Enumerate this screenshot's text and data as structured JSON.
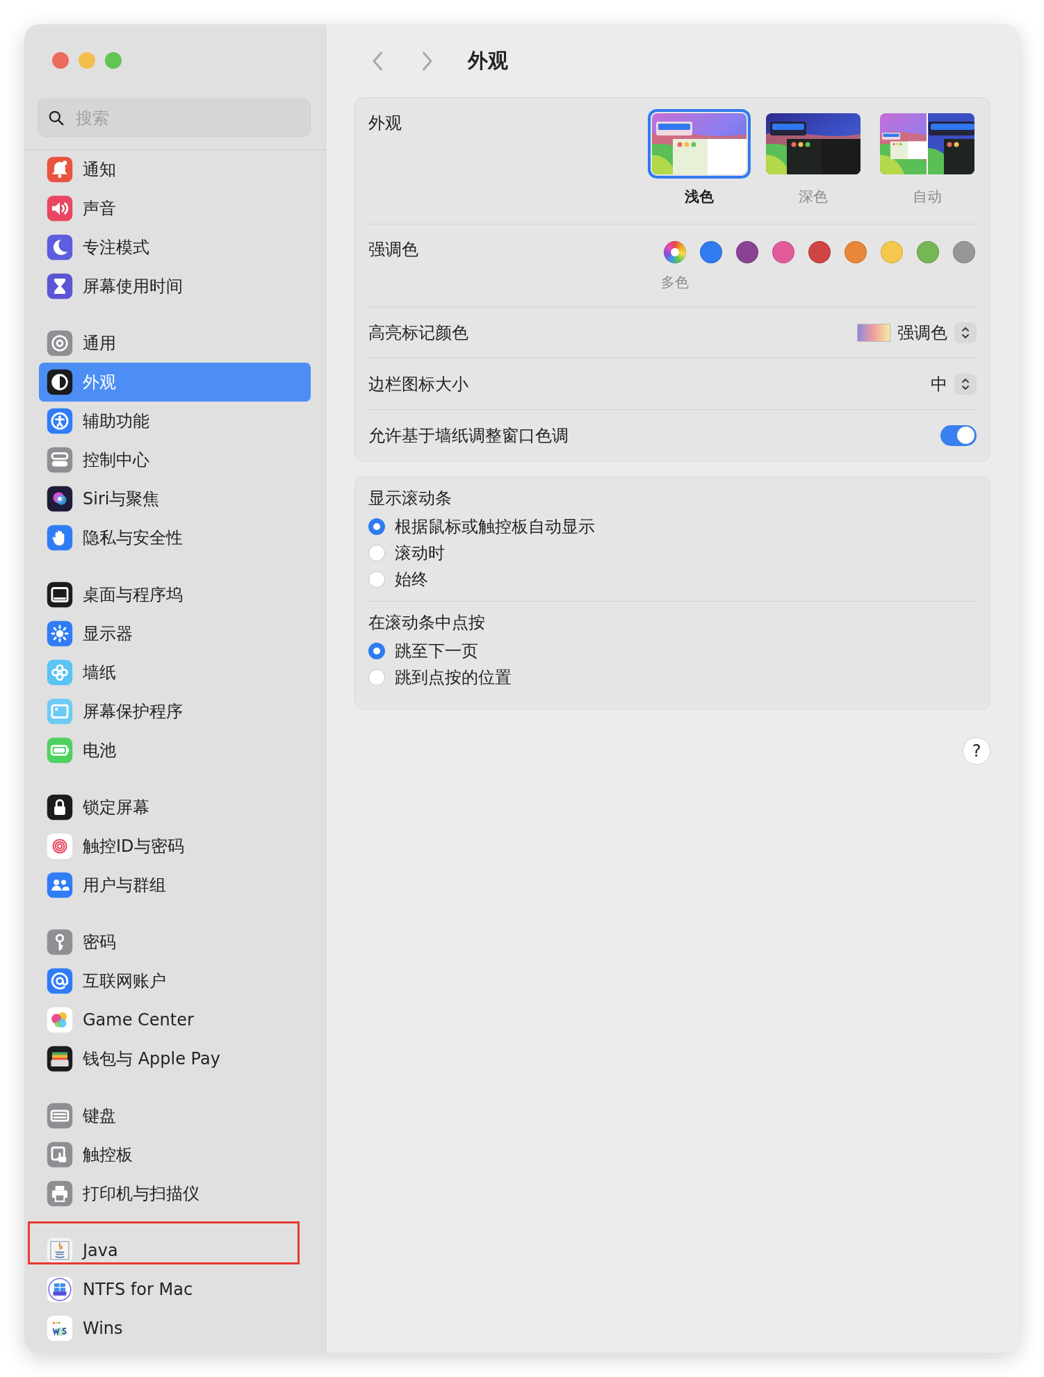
{
  "sidebar": {
    "search": {
      "placeholder": "搜索"
    },
    "groups": [
      {
        "items": [
          {
            "label": "通知",
            "selected": false,
            "highlighted": false
          },
          {
            "label": "声音",
            "selected": false,
            "highlighted": false
          },
          {
            "label": "专注模式",
            "selected": false,
            "highlighted": false
          },
          {
            "label": "屏幕使用时间",
            "selected": false,
            "highlighted": false
          }
        ]
      },
      {
        "items": [
          {
            "label": "通用",
            "selected": false,
            "highlighted": false
          },
          {
            "label": "外观",
            "selected": true,
            "highlighted": false
          },
          {
            "label": "辅助功能",
            "selected": false,
            "highlighted": false
          },
          {
            "label": "控制中心",
            "selected": false,
            "highlighted": false
          },
          {
            "label": "Siri与聚焦",
            "selected": false,
            "highlighted": false
          },
          {
            "label": "隐私与安全性",
            "selected": false,
            "highlighted": false
          }
        ]
      },
      {
        "items": [
          {
            "label": "桌面与程序坞",
            "selected": false,
            "highlighted": false
          },
          {
            "label": "显示器",
            "selected": false,
            "highlighted": false
          },
          {
            "label": "墙纸",
            "selected": false,
            "highlighted": false
          },
          {
            "label": "屏幕保护程序",
            "selected": false,
            "highlighted": false
          },
          {
            "label": "电池",
            "selected": false,
            "highlighted": false
          }
        ]
      },
      {
        "items": [
          {
            "label": "锁定屏幕",
            "selected": false,
            "highlighted": false
          },
          {
            "label": "触控ID与密码",
            "selected": false,
            "highlighted": false
          },
          {
            "label": "用户与群组",
            "selected": false,
            "highlighted": false
          }
        ]
      },
      {
        "items": [
          {
            "label": "密码",
            "selected": false,
            "highlighted": false
          },
          {
            "label": "互联网账户",
            "selected": false,
            "highlighted": false
          },
          {
            "label": "Game Center",
            "selected": false,
            "highlighted": false
          },
          {
            "label": "钱包与 Apple Pay",
            "selected": false,
            "highlighted": false
          }
        ]
      },
      {
        "items": [
          {
            "label": "键盘",
            "selected": false,
            "highlighted": false
          },
          {
            "label": "触控板",
            "selected": false,
            "highlighted": false
          },
          {
            "label": "打印机与扫描仪",
            "selected": false,
            "highlighted": false
          }
        ]
      },
      {
        "items": [
          {
            "label": "Java",
            "selected": false,
            "highlighted": true
          },
          {
            "label": "NTFS for Mac",
            "selected": false,
            "highlighted": false
          },
          {
            "label": "Wins",
            "selected": false,
            "highlighted": false
          }
        ]
      }
    ]
  },
  "header": {
    "title": "外观"
  },
  "appearance": {
    "label": "外观",
    "options": [
      {
        "label": "浅色",
        "kind": "light",
        "selected": true
      },
      {
        "label": "深色",
        "kind": "dark",
        "selected": false
      },
      {
        "label": "自动",
        "kind": "auto",
        "selected": false
      }
    ]
  },
  "accent": {
    "label": "强调色",
    "colors": [
      {
        "kind": "multicolor",
        "caption": "多色",
        "selected": true
      },
      {
        "kind": "solid",
        "color": "#2f7bf0",
        "selected": false
      },
      {
        "kind": "solid",
        "color": "#8a4293",
        "selected": false
      },
      {
        "kind": "solid",
        "color": "#e45b9c",
        "selected": false
      },
      {
        "kind": "solid",
        "color": "#cf4542",
        "selected": false
      },
      {
        "kind": "solid",
        "color": "#e8873a",
        "selected": false
      },
      {
        "kind": "solid",
        "color": "#f5c84d",
        "selected": false
      },
      {
        "kind": "solid",
        "color": "#76b755",
        "selected": false
      },
      {
        "kind": "solid",
        "color": "#979797",
        "selected": false
      }
    ]
  },
  "highlight_color": {
    "label": "高亮标记颜色",
    "value": "强调色"
  },
  "sidebar_icon_size": {
    "label": "边栏图标大小",
    "value": "中"
  },
  "wallpaper_tinting": {
    "label": "允许基于墙纸调整窗口色调",
    "on": true
  },
  "scroll_settings": [
    {
      "label": "显示滚动条",
      "options": [
        {
          "label": "根据鼠标或触控板自动显示",
          "selected": true
        },
        {
          "label": "滚动时",
          "selected": false
        },
        {
          "label": "始终",
          "selected": false
        }
      ]
    },
    {
      "label": "在滚动条中点按",
      "options": [
        {
          "label": "跳至下一页",
          "selected": true
        },
        {
          "label": "跳到点按的位置",
          "selected": false
        }
      ]
    }
  ],
  "help": "?"
}
